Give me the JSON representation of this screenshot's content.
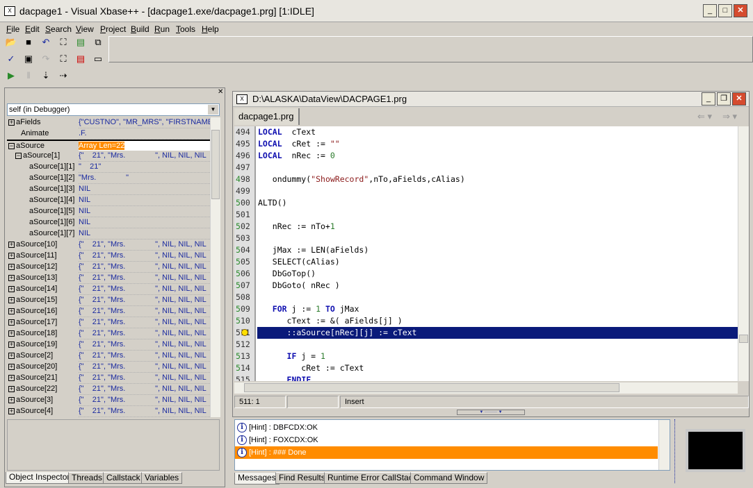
{
  "window": {
    "title": "dacpage1 - Visual Xbase++ - [dacpage1.exe/dacpage1.prg] [1:IDLE]",
    "icon": "xbase-app-icon"
  },
  "menu": [
    "File",
    "Edit",
    "Search",
    "View",
    "Project",
    "Build",
    "Run",
    "Tools",
    "Help"
  ],
  "toolbar": {
    "row1": [
      "open-folder-icon",
      "save-icon",
      "undo-icon",
      "find-icon",
      "new-file-icon",
      "project-icon"
    ],
    "row2": [
      "check-icon",
      "save-all-icon",
      "redo-icon",
      "replace-icon",
      "remove-file-icon",
      "window-icon"
    ],
    "row3": [
      "run-debug-icon",
      "pause-icon",
      "step-into-icon",
      "step-over-icon"
    ]
  },
  "inspector": {
    "object": "self (in Debugger)",
    "rows": [
      {
        "name": "aFields",
        "value": "{\"CUSTNO\", \"MR_MRS\", \"FIRSTNAME\"",
        "exp": "+",
        "indent": 0
      },
      {
        "name": "Animate",
        "value": ".F.",
        "exp": "",
        "indent": 1
      },
      {
        "name": "aSource",
        "value": "Array Len=22",
        "exp": "-",
        "indent": 0,
        "selected": true
      },
      {
        "name": "aSource[1]",
        "value": "{\"    21\", \"Mrs.              \", NIL, NIL, NIL",
        "exp": "-",
        "indent": 1
      },
      {
        "name": "aSource[1][1]",
        "value": "\"    21\"",
        "exp": "",
        "indent": 2
      },
      {
        "name": "aSource[1][2]",
        "value": "\"Mrs.              \"",
        "exp": "",
        "indent": 2
      },
      {
        "name": "aSource[1][3]",
        "value": "NIL",
        "exp": "",
        "indent": 2
      },
      {
        "name": "aSource[1][4]",
        "value": "NIL",
        "exp": "",
        "indent": 2
      },
      {
        "name": "aSource[1][5]",
        "value": "NIL",
        "exp": "",
        "indent": 2
      },
      {
        "name": "aSource[1][6]",
        "value": "NIL",
        "exp": "",
        "indent": 2
      },
      {
        "name": "aSource[1][7]",
        "value": "NIL",
        "exp": "",
        "indent": 2
      },
      {
        "name": "aSource[10]",
        "value": "{\"    21\", \"Mrs.              \", NIL, NIL, NIL",
        "exp": "+",
        "indent": 0
      },
      {
        "name": "aSource[11]",
        "value": "{\"    21\", \"Mrs.              \", NIL, NIL, NIL",
        "exp": "+",
        "indent": 0
      },
      {
        "name": "aSource[12]",
        "value": "{\"    21\", \"Mrs.              \", NIL, NIL, NIL",
        "exp": "+",
        "indent": 0
      },
      {
        "name": "aSource[13]",
        "value": "{\"    21\", \"Mrs.              \", NIL, NIL, NIL",
        "exp": "+",
        "indent": 0
      },
      {
        "name": "aSource[14]",
        "value": "{\"    21\", \"Mrs.              \", NIL, NIL, NIL",
        "exp": "+",
        "indent": 0
      },
      {
        "name": "aSource[15]",
        "value": "{\"    21\", \"Mrs.              \", NIL, NIL, NIL",
        "exp": "+",
        "indent": 0
      },
      {
        "name": "aSource[16]",
        "value": "{\"    21\", \"Mrs.              \", NIL, NIL, NIL",
        "exp": "+",
        "indent": 0
      },
      {
        "name": "aSource[17]",
        "value": "{\"    21\", \"Mrs.              \", NIL, NIL, NIL",
        "exp": "+",
        "indent": 0
      },
      {
        "name": "aSource[18]",
        "value": "{\"    21\", \"Mrs.              \", NIL, NIL, NIL",
        "exp": "+",
        "indent": 0
      },
      {
        "name": "aSource[19]",
        "value": "{\"    21\", \"Mrs.              \", NIL, NIL, NIL",
        "exp": "+",
        "indent": 0
      },
      {
        "name": "aSource[2]",
        "value": "{\"    21\", \"Mrs.              \", NIL, NIL, NIL",
        "exp": "+",
        "indent": 0
      },
      {
        "name": "aSource[20]",
        "value": "{\"    21\", \"Mrs.              \", NIL, NIL, NIL",
        "exp": "+",
        "indent": 0
      },
      {
        "name": "aSource[21]",
        "value": "{\"    21\", \"Mrs.              \", NIL, NIL, NIL",
        "exp": "+",
        "indent": 0
      },
      {
        "name": "aSource[22]",
        "value": "{\"    21\", \"Mrs.              \", NIL, NIL, NIL",
        "exp": "+",
        "indent": 0
      },
      {
        "name": "aSource[3]",
        "value": "{\"    21\", \"Mrs.              \", NIL, NIL, NIL",
        "exp": "+",
        "indent": 0
      },
      {
        "name": "aSource[4]",
        "value": "{\"    21\", \"Mrs.              \", NIL, NIL, NIL",
        "exp": "+",
        "indent": 0
      }
    ],
    "tabs": [
      "Object Inspector",
      "Threads",
      "Callstack",
      "Variables"
    ]
  },
  "editor": {
    "title": "D:\\ALASKA\\DataView\\DACPAGE1.prg",
    "file_tab": "dacpage1.prg",
    "current_line": 511,
    "lines": [
      {
        "n": "494",
        "t": [
          [
            "kw",
            "LOCAL"
          ],
          [
            "",
            "  cText"
          ]
        ]
      },
      {
        "n": "495",
        "t": [
          [
            "kw",
            "LOCAL"
          ],
          [
            "",
            "  cRet := "
          ],
          [
            "st",
            "\"\""
          ]
        ]
      },
      {
        "n": "496",
        "t": [
          [
            "kw",
            "LOCAL"
          ],
          [
            "",
            "  nRec := "
          ],
          [
            "nm",
            "0"
          ]
        ]
      },
      {
        "n": "497",
        "t": []
      },
      {
        "n": "498",
        "m": true,
        "t": [
          [
            "",
            "   ondummy("
          ],
          [
            "st",
            "\"ShowRecord\""
          ],
          [
            "",
            ",nTo,aFields,cAlias)"
          ]
        ]
      },
      {
        "n": "499",
        "t": []
      },
      {
        "n": "500",
        "m": true,
        "t": [
          [
            "",
            "ALTD()"
          ]
        ]
      },
      {
        "n": "501",
        "t": []
      },
      {
        "n": "502",
        "m": true,
        "t": [
          [
            "",
            "   nRec := nTo+"
          ],
          [
            "nm",
            "1"
          ]
        ]
      },
      {
        "n": "503",
        "t": []
      },
      {
        "n": "504",
        "m": true,
        "t": [
          [
            "",
            "   jMax := LEN(aFields)"
          ]
        ]
      },
      {
        "n": "505",
        "m": true,
        "t": [
          [
            "",
            "   SELECT(cAlias)"
          ]
        ]
      },
      {
        "n": "506",
        "m": true,
        "t": [
          [
            "",
            "   DbGoTop()"
          ]
        ]
      },
      {
        "n": "507",
        "m": true,
        "t": [
          [
            "",
            "   DbGoto( nRec )"
          ]
        ]
      },
      {
        "n": "508",
        "t": []
      },
      {
        "n": "509",
        "m": true,
        "t": [
          [
            "",
            "   "
          ],
          [
            "kw",
            "FOR"
          ],
          [
            "",
            " j := "
          ],
          [
            "nm",
            "1"
          ],
          [
            "",
            ""
          ],
          [
            "kw",
            " TO"
          ],
          [
            "",
            " jMax"
          ]
        ]
      },
      {
        "n": "510",
        "m": true,
        "t": [
          [
            "",
            "      cText := &( aFields[j] )"
          ]
        ]
      },
      {
        "n": "511",
        "cur": true,
        "t": [
          [
            "",
            "      ::aSource[nRec][j] := cText"
          ]
        ]
      },
      {
        "n": "512",
        "t": []
      },
      {
        "n": "513",
        "m": true,
        "t": [
          [
            "",
            "      "
          ],
          [
            "kw",
            "IF"
          ],
          [
            "",
            " j = "
          ],
          [
            "nm",
            "1"
          ]
        ]
      },
      {
        "n": "514",
        "m": true,
        "t": [
          [
            "",
            "         cRet := cText"
          ]
        ]
      },
      {
        "n": "515",
        "t": [
          [
            "",
            "      "
          ],
          [
            "kw",
            "ENDIF"
          ]
        ]
      }
    ],
    "status": {
      "position": "511:  1",
      "blank": "",
      "mode": "Insert"
    }
  },
  "messages": {
    "items": [
      {
        "text": "[Hint] : DBFCDX:OK"
      },
      {
        "text": "[Hint] : FOXCDX:OK"
      },
      {
        "text": "[Hint] : ### Done",
        "selected": true
      }
    ],
    "tabs": [
      "Messages",
      "Find Results",
      "Runtime Error CallStack",
      "Command Window"
    ]
  },
  "colors": {
    "selection": "#0a1a7a",
    "highlight": "#ff8c00",
    "keyword": "#1010b0"
  }
}
